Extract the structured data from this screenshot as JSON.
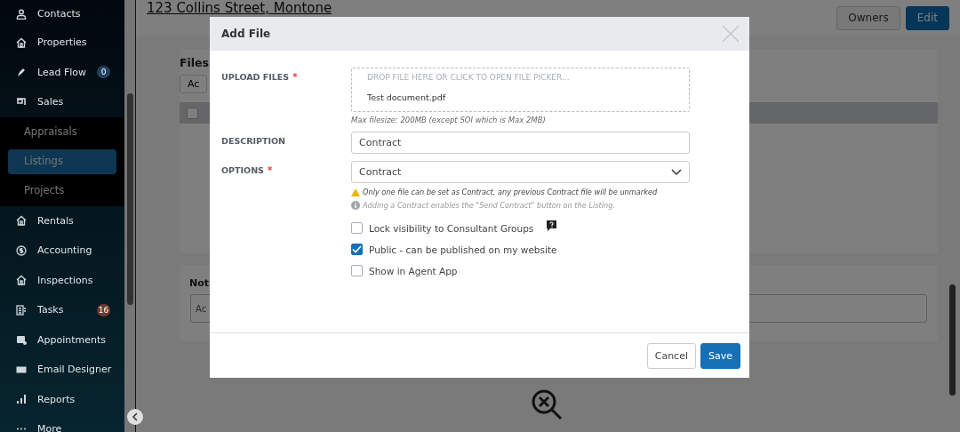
{
  "sidebar": {
    "items": [
      {
        "label": "Contacts"
      },
      {
        "label": "Properties"
      },
      {
        "label": "Lead Flow",
        "badge": "0",
        "color": "#1e4162"
      },
      {
        "label": "Sales",
        "expanded": true,
        "children": [
          {
            "label": "Appraisals",
            "selected": false
          },
          {
            "label": "Listings",
            "selected": true
          },
          {
            "label": "Projects",
            "selected": false
          }
        ]
      },
      {
        "label": "Rentals"
      },
      {
        "label": "Accounting"
      },
      {
        "label": "Inspections"
      },
      {
        "label": "Tasks",
        "badge": "16",
        "color": "#703a2d"
      },
      {
        "label": "Appointments"
      },
      {
        "label": "Email Designer"
      },
      {
        "label": "Reports"
      },
      {
        "label": "More"
      }
    ]
  },
  "header": {
    "title": "123 Collins Street, Montone",
    "buttons": [
      {
        "label": "Owners",
        "kind": "default"
      },
      {
        "label": "Edit",
        "kind": "primary"
      }
    ]
  },
  "files_card": {
    "heading": "Files",
    "add_button": "Ac",
    "select_all_checked": false
  },
  "notes_card": {
    "heading": "Not",
    "placeholder": "Ac"
  },
  "modal": {
    "title": "Add File",
    "upload": {
      "label": "UPLOAD FILES",
      "required_mark": "*",
      "drop_hint": "DROP FILE HERE OR CLICK TO OPEN FILE PICKER...",
      "file": "Test document.pdf",
      "note": "Max filesize: 200MB (except SOI which is Max 2MB)"
    },
    "description": {
      "label": "DESCRIPTION",
      "value": "Contract"
    },
    "options": {
      "label": "OPTIONS",
      "required_mark": "*",
      "value": "Contract",
      "warning": "Only one file can be set as Contract, any previous Contract file will be unmarked",
      "info": "Adding a Contract enables the \"Send Contract\" button on the Listing."
    },
    "checkboxes": [
      {
        "label": "Lock visibility to Consultant Groups",
        "checked": false,
        "help": true
      },
      {
        "label": "Public - can be published on my website",
        "checked": true,
        "help": false
      },
      {
        "label": "Show in Agent App",
        "checked": false,
        "help": false
      }
    ],
    "buttons": [
      {
        "label": "Cancel",
        "kind": "default"
      },
      {
        "label": "Save",
        "kind": "primary"
      }
    ]
  }
}
